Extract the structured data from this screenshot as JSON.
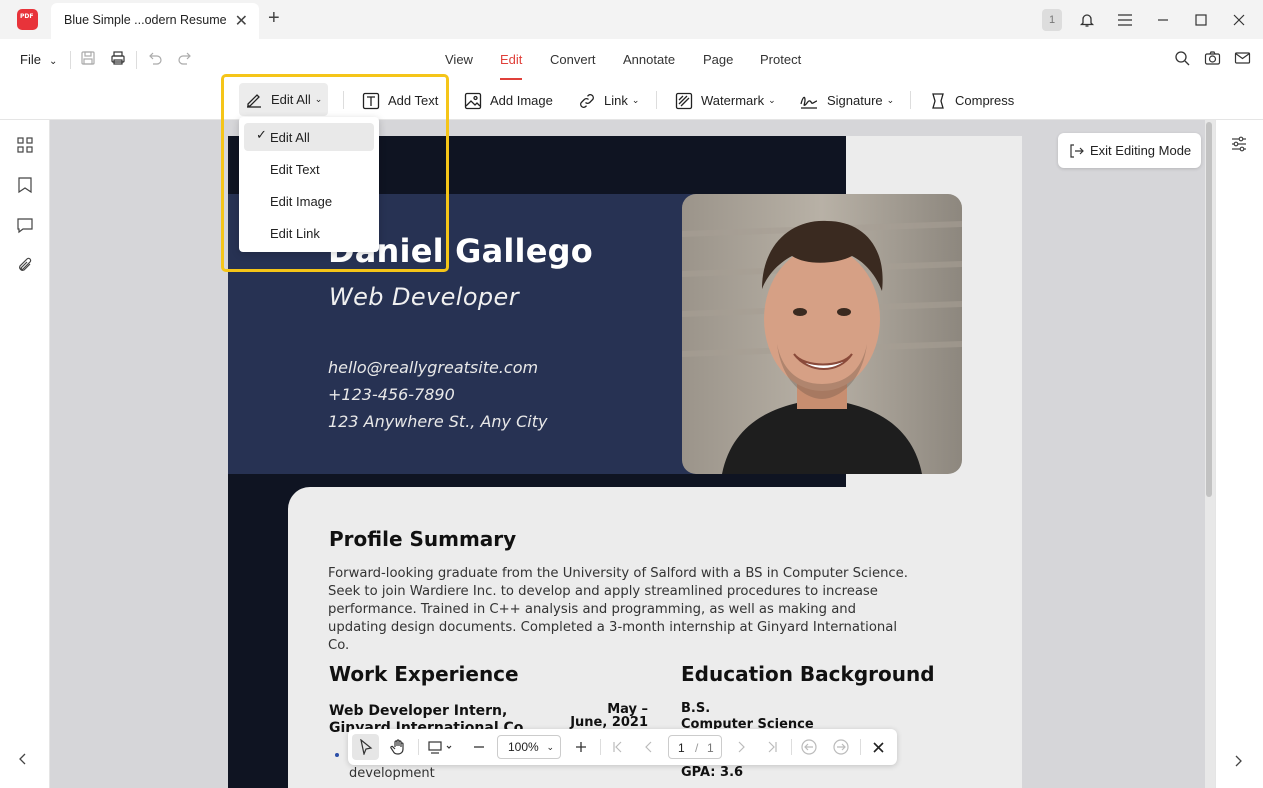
{
  "titlebar": {
    "app_logo_text": "PDF",
    "tab_title": "Blue Simple ...odern Resume",
    "close_glyph": "✕",
    "new_tab_glyph": "+",
    "page_badge": "1"
  },
  "menubar": {
    "file_label": "File",
    "tabs": [
      "View",
      "Edit",
      "Convert",
      "Annotate",
      "Page",
      "Protect"
    ],
    "active_tab": "Edit"
  },
  "toolbar": {
    "edit_all": "Edit All",
    "add_text": "Add Text",
    "add_image": "Add Image",
    "link": "Link",
    "watermark": "Watermark",
    "signature": "Signature",
    "compress": "Compress"
  },
  "dropdown": {
    "items": [
      "Edit All",
      "Edit Text",
      "Edit Image",
      "Edit Link"
    ],
    "selected": "Edit All",
    "check_glyph": "✓"
  },
  "exit_editing": "Exit Editing Mode",
  "resume": {
    "name": "Daniel Gallego",
    "role": "Web Developer",
    "email": "hello@reallygreatsite.com",
    "phone": "+123-456-7890",
    "address": "123 Anywhere St., Any City",
    "profile_heading": "Profile Summary",
    "profile_text": "Forward-looking graduate from the University of Salford with a BS in Computer Science. Seek to join Wardiere Inc. to develop and apply streamlined procedures to increase performance. Trained in C++ analysis and programming, as well as making and updating design documents. Completed a 3-month internship at Ginyard International Co.",
    "work_heading": "Work Experience",
    "job_title": "Web Developer Intern, Ginyard International Co.",
    "job_date": "May – June, 2021",
    "bullet": "development",
    "education_heading": "Education Background",
    "degree": "B.S.",
    "field": "Computer Science",
    "gpa": "GPA: 3.6"
  },
  "bottom_bar": {
    "zoom": "100%",
    "current_page": "1",
    "total_pages": "1",
    "page_separator": "/"
  },
  "colors": {
    "accent": "#e0403a",
    "highlight": "#f5c518",
    "resume_dark": "#0f1422",
    "resume_blue": "#273253"
  }
}
